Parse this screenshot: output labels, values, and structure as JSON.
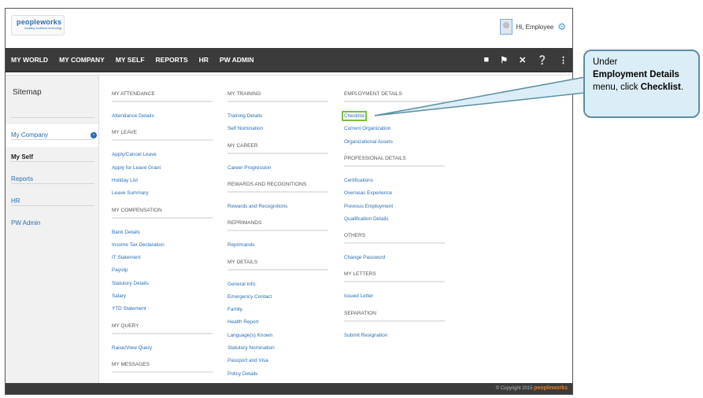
{
  "header": {
    "logo": {
      "word": "peopleworks",
      "tagline": "enabling workforce technology"
    },
    "greeting": "Hi, Employee"
  },
  "nav": {
    "items": [
      "MY WORLD",
      "MY COMPANY",
      "MY SELF",
      "REPORTS",
      "HR",
      "PW ADMIN"
    ],
    "tool_icons": [
      "book-icon",
      "flag-icon",
      "tools-icon",
      "help-icon",
      "menu-icon"
    ]
  },
  "sidebar": {
    "title": "Sitemap",
    "items": [
      "My Company",
      "My Self",
      "Reports",
      "HR",
      "PW Admin"
    ],
    "active": "My Self"
  },
  "columns": [
    {
      "sections": [
        {
          "heading": "MY ATTENDANCE",
          "links": [
            "Attendance Details"
          ]
        },
        {
          "heading": "MY LEAVE",
          "links": [
            "Apply/Cancel Leave",
            "Apply for Leave Grant",
            "Holiday List",
            "Leave Summary"
          ]
        },
        {
          "heading": "MY COMPENSATION",
          "links": [
            "Bank Details",
            "Income Tax Declaration",
            "IT Statement",
            "Payslip",
            "Statutory Details",
            "Salary",
            "YTD Statement"
          ]
        },
        {
          "heading": "MY QUERY",
          "links": [
            "Raise/View Query"
          ]
        },
        {
          "heading": "MY MESSAGES",
          "links": []
        }
      ]
    },
    {
      "sections": [
        {
          "heading": "MY TRAINING",
          "links": [
            "Training Details",
            "Self Nomination"
          ]
        },
        {
          "heading": "MY CAREER",
          "links": [
            "Career Progression"
          ]
        },
        {
          "heading": "REWARDS AND RECOGNITIONS",
          "links": [
            "Rewards and Recognitions"
          ]
        },
        {
          "heading": "REPRIMANDS",
          "links": [
            "Reprimands"
          ]
        },
        {
          "heading": "MY DETAILS",
          "links": [
            "General Info.",
            "Emergency Contact",
            "Family",
            "Health Report",
            "Language(s) Known",
            "Statutory Nomination",
            "Passport and Visa",
            "Policy Details"
          ]
        }
      ]
    },
    {
      "sections": [
        {
          "heading": "EMPLOYMENT DETAILS",
          "links": [
            "Checklist",
            "Current Organization",
            "Organizational Assets"
          ]
        },
        {
          "heading": "PROFESSIONAL DETAILS",
          "links": [
            "Certifications",
            "Overseas Experience",
            "Previous Employment",
            "Qualification Details"
          ]
        },
        {
          "heading": "OTHERS",
          "links": [
            "Change Password"
          ]
        },
        {
          "heading": "MY LETTERS",
          "links": [
            "Issued Letter"
          ]
        },
        {
          "heading": "SEPARATION",
          "links": [
            "Submit Resignation"
          ]
        }
      ]
    }
  ],
  "footer": {
    "copyright": "© Copyright 2015",
    "brand": "peopleworks"
  },
  "callout": {
    "pre": "Under",
    "bold1": "Employment Details",
    "mid": "menu, click",
    "bold2": "Checklist",
    "post": "."
  },
  "colors": {
    "nav_bg": "#3b3b3b",
    "link": "#2a6db4",
    "highlight": "#7bbf3a",
    "callout_bg": "#dbeef7",
    "callout_border": "#5a8ea4"
  }
}
